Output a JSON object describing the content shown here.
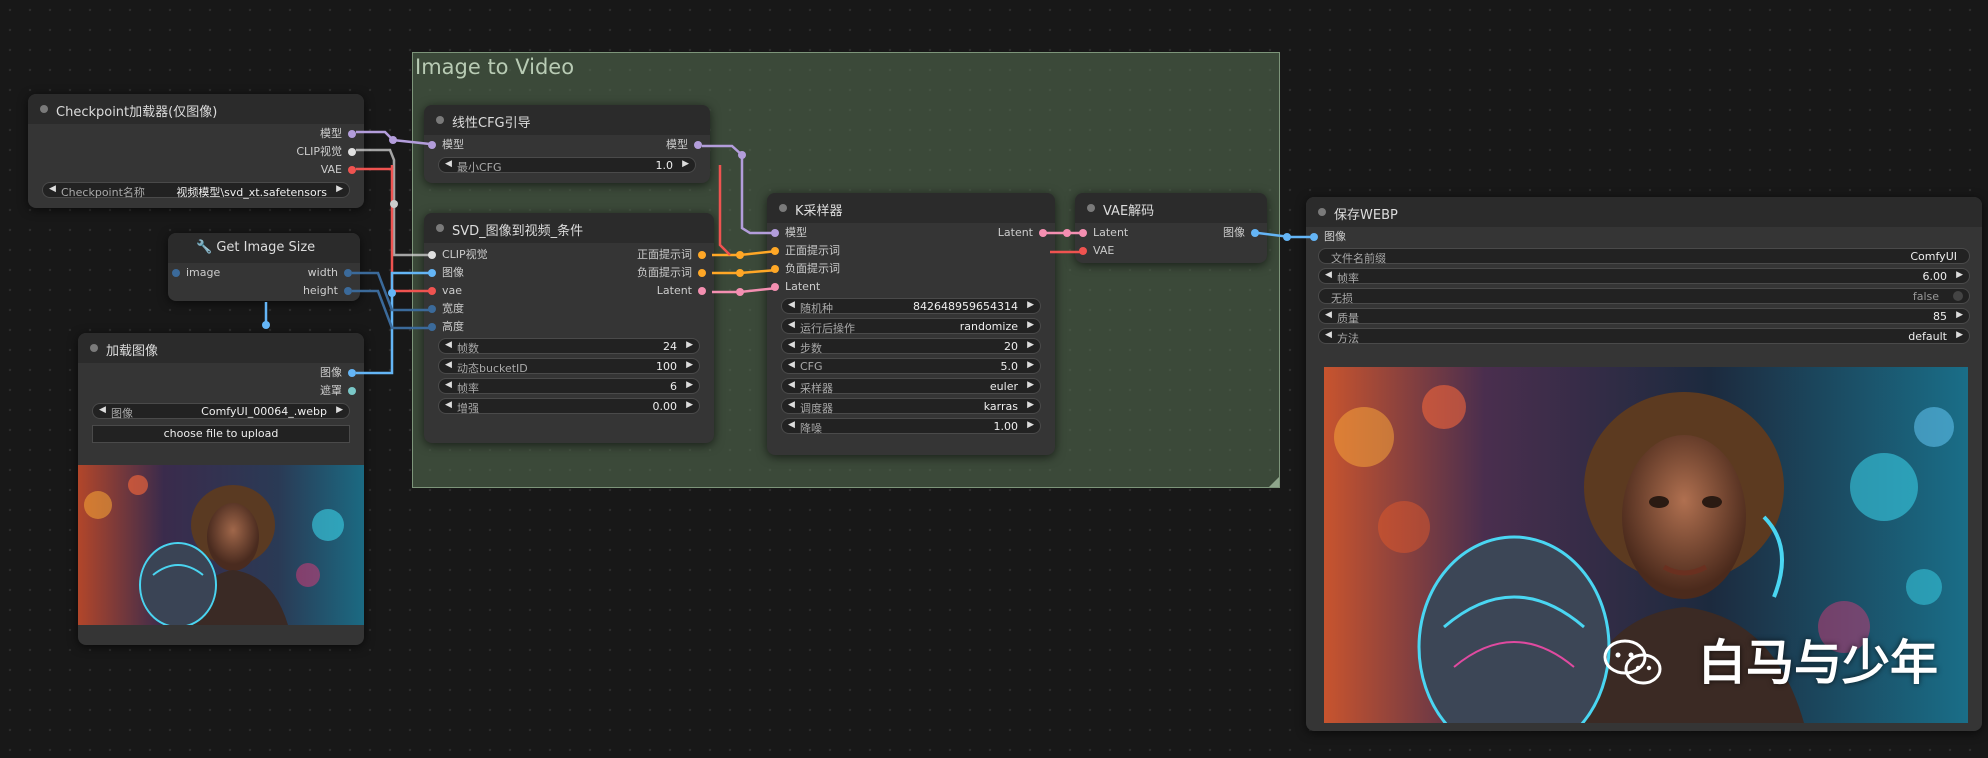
{
  "group": {
    "title": "Image to Video"
  },
  "nodes": {
    "checkpoint": {
      "title": "Checkpoint加载器(仅图像)",
      "outputs": [
        "模型",
        "CLIP视觉",
        "VAE"
      ],
      "widget": {
        "label": "Checkpoint名称",
        "value": "视频模型\\svd_xt.safetensors"
      }
    },
    "get_size": {
      "title": "Get Image Size",
      "inputs": [
        "image"
      ],
      "outputs": [
        "width",
        "height"
      ]
    },
    "load_image": {
      "title": "加载图像",
      "outputs": [
        "图像",
        "遮罩"
      ],
      "widget": {
        "label": "图像",
        "value": "ComfyUI_00064_.webp"
      },
      "upload_label": "choose file to upload"
    },
    "cfg_guide": {
      "title": "线性CFG引导",
      "inputs": [
        "模型"
      ],
      "outputs": [
        "模型"
      ],
      "widget": {
        "label": "最小CFG",
        "value": "1.0"
      }
    },
    "svd_cond": {
      "title": "SVD_图像到视频_条件",
      "inputs": [
        "CLIP视觉",
        "图像",
        "vae",
        "宽度",
        "高度"
      ],
      "outputs": [
        "正面提示词",
        "负面提示词",
        "Latent"
      ],
      "widgets": [
        {
          "label": "帧数",
          "value": "24"
        },
        {
          "label": "动态bucketID",
          "value": "100"
        },
        {
          "label": "帧率",
          "value": "6"
        },
        {
          "label": "增强",
          "value": "0.00"
        }
      ]
    },
    "ksampler": {
      "title": "K采样器",
      "inputs": [
        "模型",
        "正面提示词",
        "负面提示词",
        "Latent"
      ],
      "outputs": [
        "Latent"
      ],
      "widgets": [
        {
          "label": "随机种",
          "value": "842648959654314"
        },
        {
          "label": "运行后操作",
          "value": "randomize"
        },
        {
          "label": "步数",
          "value": "20"
        },
        {
          "label": "CFG",
          "value": "5.0"
        },
        {
          "label": "采样器",
          "value": "euler"
        },
        {
          "label": "调度器",
          "value": "karras"
        },
        {
          "label": "降噪",
          "value": "1.00"
        }
      ]
    },
    "vae_decode": {
      "title": "VAE解码",
      "inputs": [
        "Latent",
        "VAE"
      ],
      "outputs": [
        "图像"
      ]
    },
    "save_webp": {
      "title": "保存WEBP",
      "inputs": [
        "图像"
      ],
      "widgets": [
        {
          "label": "文件名前缀",
          "value": "ComfyUI"
        },
        {
          "label": "帧率",
          "value": "6.00"
        },
        {
          "label": "无损",
          "value": "false"
        },
        {
          "label": "质量",
          "value": "85"
        },
        {
          "label": "方法",
          "value": "default"
        }
      ],
      "watermark": "白马与少年"
    }
  },
  "colors": {
    "model": "#b39ddb",
    "clip": "#e0e0e0",
    "vae": "#ef5350",
    "image": "#64b5f6",
    "int": "#3b6a9a",
    "conditioning": "#ffa726",
    "latent": "#f48fb1",
    "mask": "#7ac8c8",
    "group_bg": "#5a7355",
    "node_bg": "#353535"
  }
}
